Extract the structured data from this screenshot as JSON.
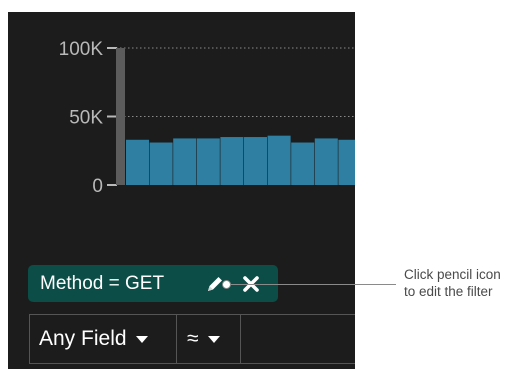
{
  "chart_data": {
    "type": "bar",
    "ylim": [
      0,
      100000
    ],
    "y_ticks": [
      {
        "value": 0,
        "label": "0"
      },
      {
        "value": 50000,
        "label": "50K"
      },
      {
        "value": 100000,
        "label": "100K"
      }
    ],
    "values": [
      33000,
      31000,
      34000,
      34000,
      35000,
      35000,
      36000,
      31000,
      34000,
      33000
    ],
    "selection_bar_value": 100000,
    "grid": true,
    "colors": {
      "bar": "#2f7fa3",
      "selection": "#5c5c5c",
      "tick_text": "#b9b9b9",
      "grid": "#8a8a8a"
    }
  },
  "filter": {
    "label": "Method = GET",
    "background": "#0d4d47"
  },
  "query_bar": {
    "field_select": "Any Field",
    "operator_select": "≈",
    "value": ""
  },
  "callout": {
    "line1": "Click pencil icon",
    "line2": "to edit the filter"
  }
}
